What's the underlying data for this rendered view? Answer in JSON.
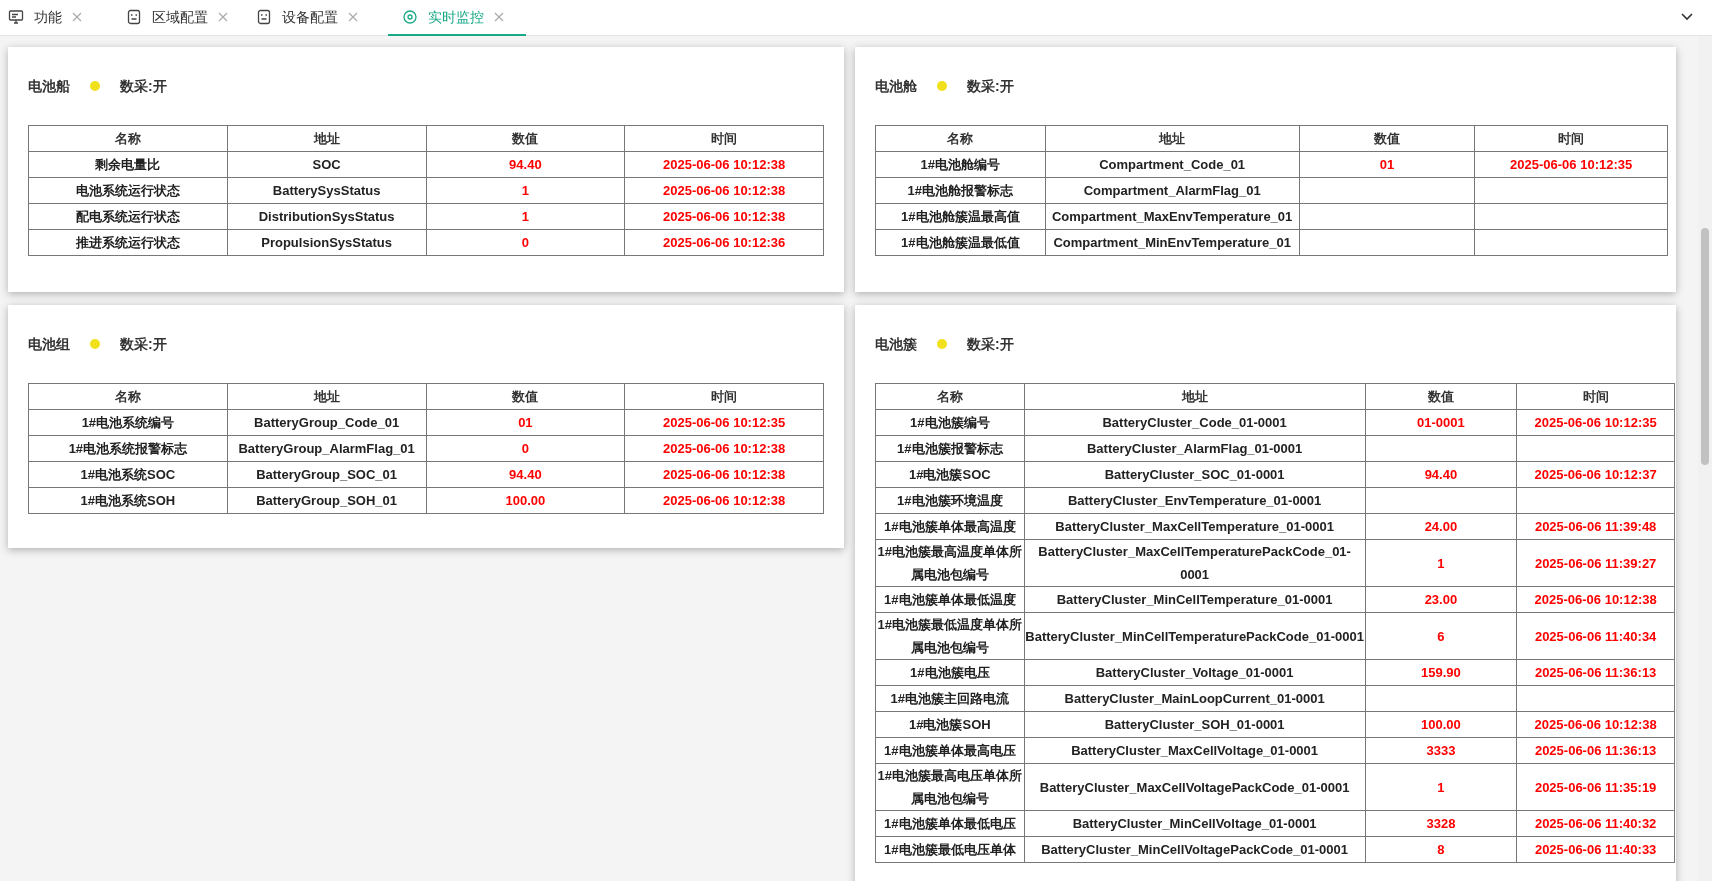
{
  "tabs": [
    {
      "label": "功能",
      "selected": false
    },
    {
      "label": "区域配置",
      "selected": false
    },
    {
      "label": "设备配置",
      "selected": false
    },
    {
      "label": "实时监控",
      "selected": true
    }
  ],
  "panels": [
    {
      "title": "电池船",
      "color": "#f0e11c",
      "status": "数采:开",
      "columns": [
        "名称",
        "地址",
        "数值",
        "时间"
      ],
      "rows": [
        {
          "name": "剩余电量比",
          "address": "SOC",
          "value": "94.40",
          "time": "2025-06-06 10:12:38"
        },
        {
          "name": "电池系统运行状态",
          "address": "BatterySysStatus",
          "value": "1",
          "time": "2025-06-06 10:12:38"
        },
        {
          "name": "配电系统运行状态",
          "address": "DistributionSysStatus",
          "value": "1",
          "time": "2025-06-06 10:12:38"
        },
        {
          "name": "推进系统运行状态",
          "address": "PropulsionSysStatus",
          "value": "0",
          "time": "2025-06-06 10:12:36"
        }
      ]
    },
    {
      "title": "电池舱",
      "color": "#f0e11c",
      "status": "数采:开",
      "columns": [
        "名称",
        "地址",
        "数值",
        "时间"
      ],
      "rows": [
        {
          "name": "1#电池舱编号",
          "address": "Compartment_Code_01",
          "value": "01",
          "time": "2025-06-06 10:12:35"
        },
        {
          "name": "1#电池舱报警标志",
          "address": "Compartment_AlarmFlag_01"
        },
        {
          "name": "1#电池舱簇温最高值",
          "address": "Compartment_MaxEnvTemperature_01"
        },
        {
          "name": "1#电池舱簇温最低值",
          "address": "Compartment_MinEnvTemperature_01"
        }
      ]
    },
    {
      "title": "电池组",
      "color": "#f0e11c",
      "status": "数采:开",
      "columns": [
        "名称",
        "地址",
        "数值",
        "时间"
      ],
      "rows": [
        {
          "name": "1#电池系统编号",
          "address": "BatteryGroup_Code_01",
          "value": "01",
          "time": "2025-06-06 10:12:35"
        },
        {
          "name": "1#电池系统报警标志",
          "address": "BatteryGroup_AlarmFlag_01",
          "value": "0",
          "time": "2025-06-06 10:12:38"
        },
        {
          "name": "1#电池系统SOC",
          "address": "BatteryGroup_SOC_01",
          "value": "94.40",
          "time": "2025-06-06 10:12:38"
        },
        {
          "name": "1#电池系统SOH",
          "address": "BatteryGroup_SOH_01",
          "value": "100.00",
          "time": "2025-06-06 10:12:38"
        }
      ]
    },
    {
      "title": "电池簇",
      "color": "#f0e11c",
      "status": "数采:开",
      "columns": [
        "名称",
        "地址",
        "数值",
        "时间"
      ],
      "rows": [
        {
          "name": "1#电池簇编号",
          "address": "BatteryCluster_Code_01-0001",
          "value": "01-0001",
          "time": "2025-06-06 10:12:35"
        },
        {
          "name": "1#电池簇报警标志",
          "address": "BatteryCluster_AlarmFlag_01-0001"
        },
        {
          "name": "1#电池簇SOC",
          "address": "BatteryCluster_SOC_01-0001",
          "value": "94.40",
          "time": "2025-06-06 10:12:37"
        },
        {
          "name": "1#电池簇环境温度",
          "address": "BatteryCluster_EnvTemperature_01-0001"
        },
        {
          "name": "1#电池簇单体最高温度",
          "address": "BatteryCluster_MaxCellTemperature_01-0001",
          "value": "24.00",
          "time": "2025-06-06 11:39:48"
        },
        {
          "name": "1#电池簇最高温度单体所属电池包编号",
          "address": "BatteryCluster_MaxCellTemperaturePackCode_01-0001",
          "value": "1",
          "time": "2025-06-06 11:39:27"
        },
        {
          "name": "1#电池簇单体最低温度",
          "address": "BatteryCluster_MinCellTemperature_01-0001",
          "value": "23.00",
          "time": "2025-06-06 10:12:38"
        },
        {
          "name": "1#电池簇最低温度单体所属电池包编号",
          "address": "BatteryCluster_MinCellTemperaturePackCode_01-0001",
          "value": "6",
          "time": "2025-06-06 11:40:34"
        },
        {
          "name": "1#电池簇电压",
          "address": "BatteryCluster_Voltage_01-0001",
          "value": "159.90",
          "time": "2025-06-06 11:36:13"
        },
        {
          "name": "1#电池簇主回路电流",
          "address": "BatteryCluster_MainLoopCurrent_01-0001"
        },
        {
          "name": "1#电池簇SOH",
          "address": "BatteryCluster_SOH_01-0001",
          "value": "100.00",
          "time": "2025-06-06 10:12:38"
        },
        {
          "name": "1#电池簇单体最高电压",
          "address": "BatteryCluster_MaxCellVoltage_01-0001",
          "value": "3333",
          "time": "2025-06-06 11:36:13"
        },
        {
          "name": "1#电池簇最高电压单体所属电池包编号",
          "address": "BatteryCluster_MaxCellVoltagePackCode_01-0001",
          "value": "1",
          "time": "2025-06-06 11:35:19"
        },
        {
          "name": "1#电池簇单体最低电压",
          "address": "BatteryCluster_MinCellVoltage_01-0001",
          "value": "3328",
          "time": "2025-06-06 11:40:32"
        },
        {
          "name": "1#电池簇最低电压单体",
          "address": "BatteryCluster_MinCellVoltagePackCode_01-0001",
          "value": "8",
          "time": "2025-06-06 11:40:33"
        }
      ]
    }
  ]
}
